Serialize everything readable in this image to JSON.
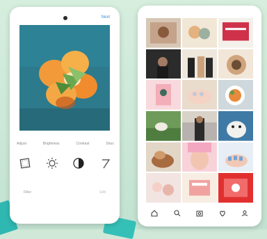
{
  "left_screen": {
    "next_label": "Next",
    "tools": [
      {
        "label": "Adjust",
        "icon": "adjust-icon"
      },
      {
        "label": "Brightness",
        "icon": "brightness-icon"
      },
      {
        "label": "Contrast",
        "icon": "contrast-icon"
      },
      {
        "label": "Struc",
        "icon": "structure-icon"
      }
    ],
    "bottom": {
      "filter_label": "Filter",
      "cancel_label": "Edit"
    }
  },
  "right_screen": {
    "tabs": [
      "home-icon",
      "search-icon",
      "camera-icon",
      "activity-icon",
      "profile-icon"
    ]
  },
  "colors": {
    "background": "#cfe8d8",
    "accent_link": "#3f8fd8",
    "teal_shapes": "#2fb8b1"
  }
}
